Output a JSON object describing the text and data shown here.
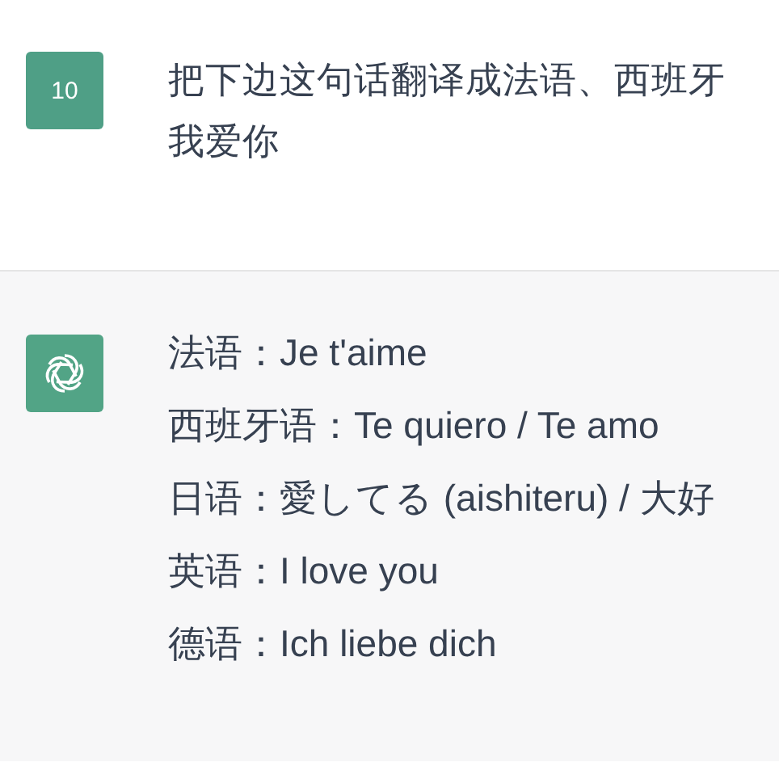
{
  "messages": [
    {
      "kind": "user",
      "avatar": "10",
      "lines": [
        "把下边这句话翻译成法语、西班牙",
        "我爱你"
      ]
    },
    {
      "kind": "assistant",
      "lines": [
        "法语：Je t'aime",
        "西班牙语：Te quiero / Te amo",
        "日语：愛してる (aishiteru) / 大好",
        "英语：I love you",
        "德语：Ich liebe dich"
      ]
    }
  ]
}
